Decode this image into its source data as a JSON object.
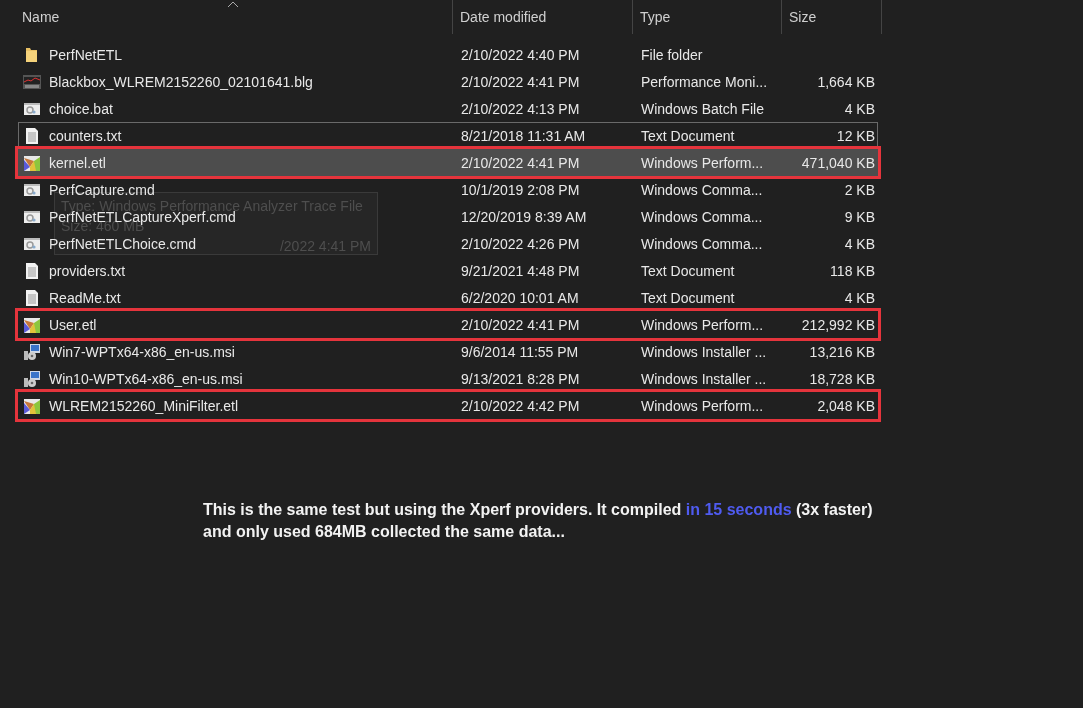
{
  "columns": [
    {
      "label": "Name",
      "sorted": true
    },
    {
      "label": "Date modified"
    },
    {
      "label": "Type"
    },
    {
      "label": "Size"
    }
  ],
  "files": [
    {
      "kind": "folder",
      "name": "PerfNetETL",
      "date": "2/10/2022 4:40 PM",
      "type": "File folder",
      "selected": false,
      "focused": false,
      "marked": false
    },
    {
      "kind": "perfmon",
      "name": "Blackbox_WLREM2152260_02101641.blg",
      "date": "2/10/2022 4:41 PM",
      "type": "Performance Moni...",
      "size": "1,664 KB",
      "selected": false,
      "focused": false,
      "marked": false
    },
    {
      "kind": "script",
      "name": "choice.bat",
      "date": "2/10/2022 4:13 PM",
      "type": "Windows Batch File",
      "size": "4 KB",
      "selected": false,
      "focused": false,
      "marked": false
    },
    {
      "kind": "text",
      "name": "counters.txt",
      "date": "8/21/2018 11:31 AM",
      "type": "Text Document",
      "size": "12 KB",
      "selected": false,
      "focused": true,
      "marked": false
    },
    {
      "kind": "trace",
      "name": "kernel.etl",
      "date": "2/10/2022 4:41 PM",
      "type": "Windows Perform...",
      "size": "471,040 KB",
      "selected": true,
      "focused": false,
      "marked": true
    },
    {
      "kind": "script",
      "name": "PerfCapture.cmd",
      "date": "10/1/2019 2:08 PM",
      "type": "Windows Comma...",
      "size": "2 KB",
      "selected": false,
      "focused": false,
      "marked": false
    },
    {
      "kind": "script",
      "name": "PerfNetETLCaptureXperf.cmd",
      "date": "12/20/2019 8:39 AM",
      "type": "Windows Comma...",
      "size": "9 KB",
      "selected": false,
      "focused": false,
      "marked": false
    },
    {
      "kind": "script",
      "name": "PerfNetETLChoice.cmd",
      "date": "2/10/2022 4:26 PM",
      "type": "Windows Comma...",
      "size": "4 KB",
      "selected": false,
      "focused": false,
      "marked": false
    },
    {
      "kind": "text",
      "name": "providers.txt",
      "date": "9/21/2021 4:48 PM",
      "type": "Text Document",
      "size": "118 KB",
      "selected": false,
      "focused": false,
      "marked": false
    },
    {
      "kind": "text",
      "name": "ReadMe.txt",
      "date": "6/2/2020 10:01 AM",
      "type": "Text Document",
      "size": "4 KB",
      "selected": false,
      "focused": false,
      "marked": false
    },
    {
      "kind": "trace",
      "name": "User.etl",
      "date": "2/10/2022 4:41 PM",
      "type": "Windows Perform...",
      "size": "212,992 KB",
      "selected": false,
      "focused": false,
      "marked": true
    },
    {
      "kind": "installer",
      "name": "Win7-WPTx64-x86_en-us.msi",
      "date": "9/6/2014 11:55 PM",
      "type": "Windows Installer ...",
      "size": "13,216 KB",
      "selected": false,
      "focused": false,
      "marked": false
    },
    {
      "kind": "installer",
      "name": "Win10-WPTx64-x86_en-us.msi",
      "date": "9/13/2021 8:28 PM",
      "type": "Windows Installer ...",
      "size": "18,728 KB",
      "selected": false,
      "focused": false,
      "marked": false
    },
    {
      "kind": "trace",
      "name": "WLREM2152260_MiniFilter.etl",
      "date": "2/10/2022 4:42 PM",
      "type": "Windows Perform...",
      "size": "2,048 KB",
      "selected": false,
      "focused": false,
      "marked": true
    }
  ],
  "tooltip": {
    "type_line": "Type: Windows Performance Analyzer Trace File",
    "size_line": "Size: 460 MB",
    "date_line": "/2022 4:41 PM"
  },
  "note": [
    {
      "text": "This is the same test but using the Xperf providers. It compiled ",
      "emphasis": false
    },
    {
      "text": "in 15 seconds",
      "emphasis": true
    },
    {
      "text": " (3x faster) and only used 684MB collected the same data...",
      "emphasis": false
    }
  ]
}
